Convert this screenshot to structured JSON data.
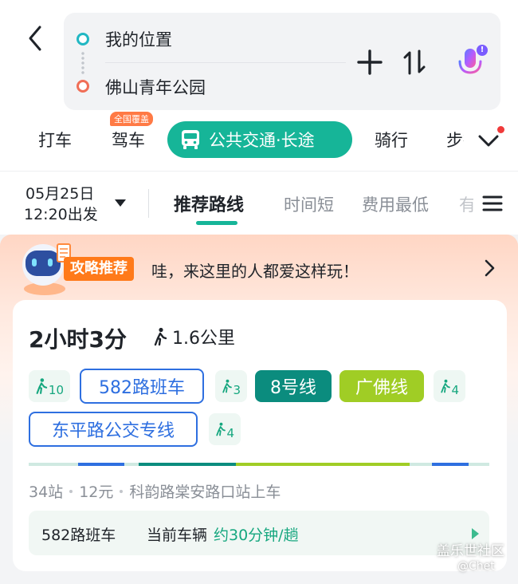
{
  "route": {
    "start": "我的位置",
    "end": "佛山青年公园"
  },
  "modes": {
    "taxi": "打车",
    "drive": "驾车",
    "drive_badge": "全国覆盖",
    "transit": "公共交通·长途",
    "ride": "骑行",
    "walk": "步行"
  },
  "depart": {
    "date": "05月25日",
    "time": "12:20出发"
  },
  "sort_tabs": {
    "recommended": "推荐路线",
    "shortest": "时间短",
    "cheapest": "费用最低",
    "more": "有"
  },
  "promo": {
    "tag": "攻略推荐",
    "text": "哇，来这里的人都爱这样玩！"
  },
  "plan": {
    "duration": "2小时3分",
    "walk_distance": "1.6公里",
    "steps": {
      "walk1": "10",
      "bus1": "582路班车",
      "walk2": "3",
      "metro": "8号线",
      "walk3": "",
      "rail": "广佛线",
      "walk4": "4",
      "bus2": "东平路公交专线",
      "walk5": "4"
    },
    "stations": "34站",
    "fare": "12元",
    "board_at": "科韵路棠安路口站上车",
    "next_bus_name": "582路班车",
    "next_bus_current": "当前车辆",
    "next_bus_freq": "约30分钟/趟"
  },
  "colors": {
    "accent": "#16b598",
    "bus": "#2e6fe0",
    "metro8": "#0b8c7e",
    "guangfo": "#a0cd25",
    "promo_tag": "#ff7a1a"
  },
  "watermark": {
    "site": "盖乐世社区",
    "user": "@Chet"
  }
}
